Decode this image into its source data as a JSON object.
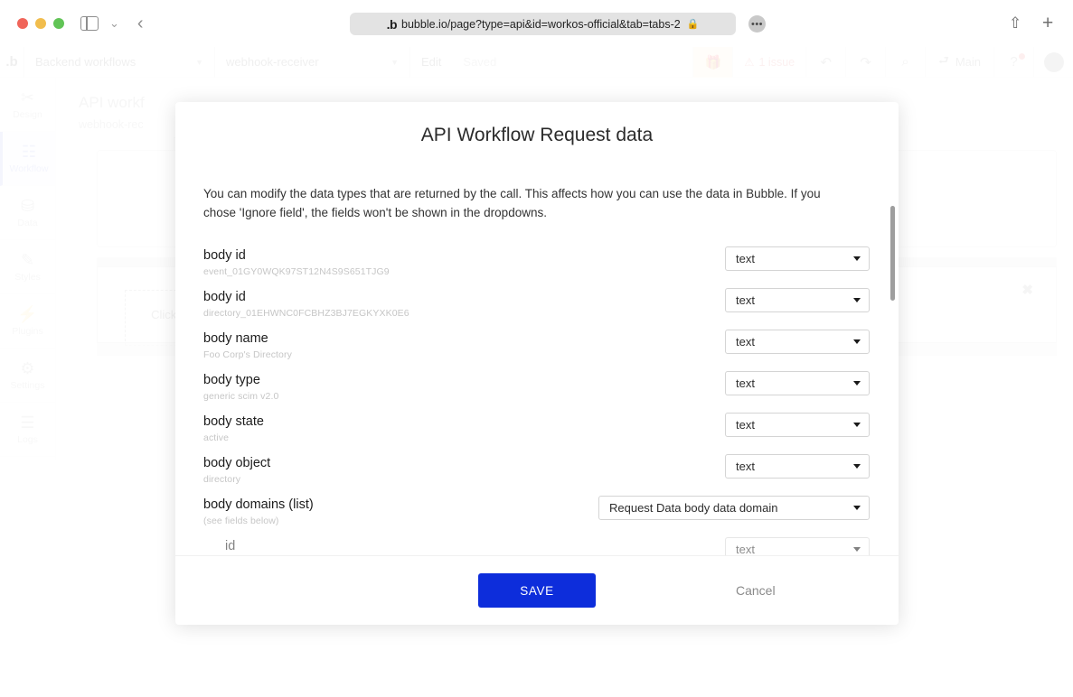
{
  "browser": {
    "url": "bubble.io/page?type=api&id=workos-official&tab=tabs-2",
    "logo_text": ".b",
    "lock": "\u0001",
    "more": "•••",
    "back": "‹",
    "chevron": "⌄",
    "share": "⇧",
    "plus": "+"
  },
  "app_toolbar": {
    "logo": ".b",
    "workflow_scope": "Backend workflows",
    "workflow_name": "webhook-receiver",
    "edit_label": "Edit",
    "saved_label": "Saved",
    "issue_label": "1 issue",
    "branch_label": "Main",
    "undo": "↶",
    "redo": "↷",
    "search": "⌕",
    "gift": "Ἰ1",
    "help": "?"
  },
  "sidebar": {
    "items": [
      {
        "label": "Design",
        "glyph": "✂",
        "active": false
      },
      {
        "label": "Workflow",
        "glyph": "☷",
        "active": true
      },
      {
        "label": "Data",
        "glyph": "⛁",
        "active": false
      },
      {
        "label": "Styles",
        "glyph": "✎",
        "active": false
      },
      {
        "label": "Plugins",
        "glyph": "⚡",
        "active": false
      },
      {
        "label": "Settings",
        "glyph": "⚙",
        "active": false
      },
      {
        "label": "Logs",
        "glyph": "☰",
        "active": false
      }
    ],
    "expand_arrow": "▶"
  },
  "background": {
    "card_title": "API workf",
    "card_subtitle": "webhook-rec",
    "click_here": "Click here",
    "close_x": "✖"
  },
  "modal": {
    "title": "API Workflow Request data",
    "description": "You can modify the data types that are returned by the call. This affects how you can use the data in Bubble. If you chose 'Ignore field', the fields won't be shown in the dropdowns.",
    "fields": [
      {
        "name": "body id",
        "value": "event_01GY0WQK97ST12N4S9S651TJG9",
        "type": "text",
        "wide": false,
        "indent": false
      },
      {
        "name": "body id",
        "value": "directory_01EHWNC0FCBHZ3BJ7EGKYXK0E6",
        "type": "text",
        "wide": false,
        "indent": false
      },
      {
        "name": "body name",
        "value": "Foo Corp's Directory",
        "type": "text",
        "wide": false,
        "indent": false
      },
      {
        "name": "body type",
        "value": "generic scim v2.0",
        "type": "text",
        "wide": false,
        "indent": false
      },
      {
        "name": "body state",
        "value": "active",
        "type": "text",
        "wide": false,
        "indent": false
      },
      {
        "name": "body object",
        "value": "directory",
        "type": "text",
        "wide": false,
        "indent": false
      },
      {
        "name": "body domains (list)",
        "value": "(see fields below)",
        "type": "Request Data body data domain",
        "wide": true,
        "indent": false
      },
      {
        "name": "id",
        "value": "",
        "type": "text",
        "wide": false,
        "indent": true
      }
    ],
    "save_label": "SAVE",
    "cancel_label": "Cancel",
    "save_color": "#0d2ddb"
  }
}
